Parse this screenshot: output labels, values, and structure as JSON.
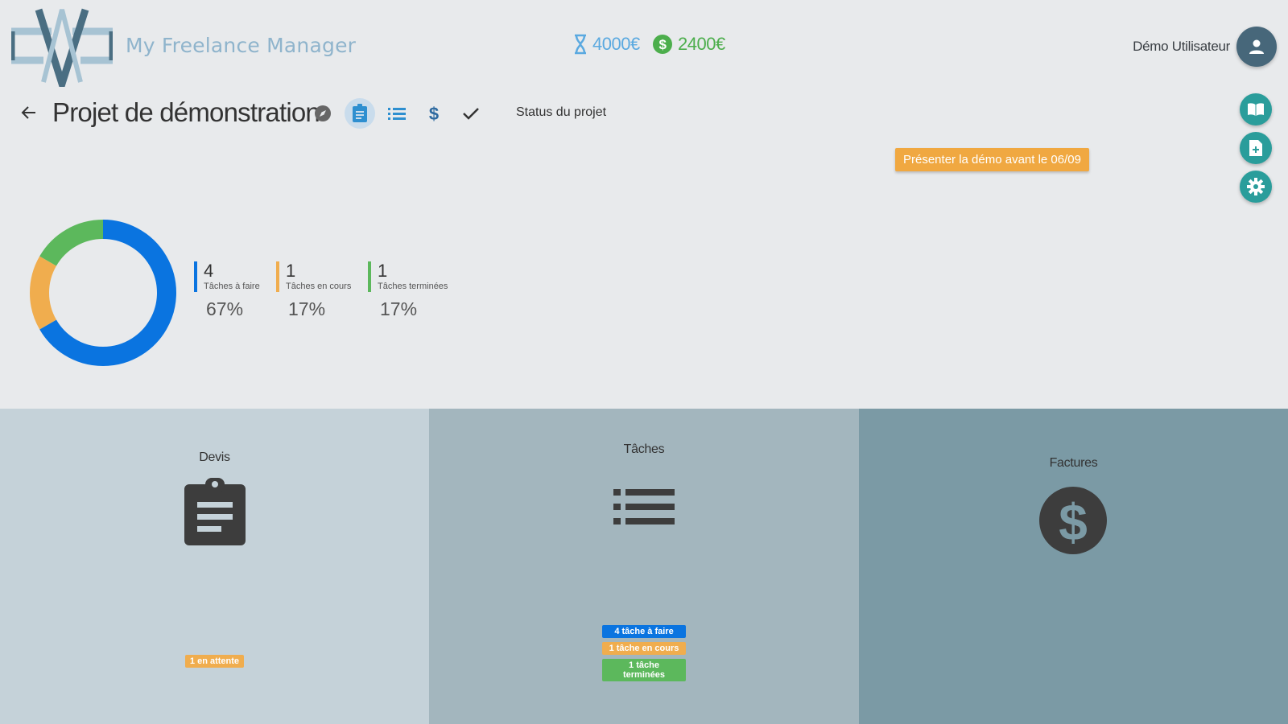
{
  "app": {
    "title": "My Freelance Manager"
  },
  "header": {
    "time_total": "4000€",
    "money_total": "2400€",
    "user_name": "Démo Utilisateur"
  },
  "project": {
    "title": "Projet de démonstration",
    "status_label": "Status du projet",
    "deadline": "Présenter la démo avant le 06/09",
    "nav_icons": [
      "compass-icon",
      "clipboard-icon",
      "list-icon",
      "dollar-icon",
      "check-icon"
    ]
  },
  "fab_icons": [
    "book-icon",
    "add-document-icon",
    "gear-icon"
  ],
  "colors": {
    "todo": "#0a74e0",
    "in_progress": "#f0ad4e",
    "done": "#5cb85c",
    "accent": "#2a9d9b"
  },
  "stats": [
    {
      "count": "4",
      "label": "Tâches à faire",
      "pct": "67%",
      "value": 4
    },
    {
      "count": "1",
      "label": "Tâches en cours",
      "pct": "17%",
      "value": 1
    },
    {
      "count": "1",
      "label": "Tâches terminées",
      "pct": "17%",
      "value": 1
    }
  ],
  "panels": {
    "devis": {
      "title": "Devis",
      "badge": "1 en attente"
    },
    "taches": {
      "title": "Tâches",
      "badges": [
        "4 tâche à faire",
        "1 tâche en cours",
        "1 tâche terminées"
      ]
    },
    "factures": {
      "title": "Factures"
    }
  }
}
